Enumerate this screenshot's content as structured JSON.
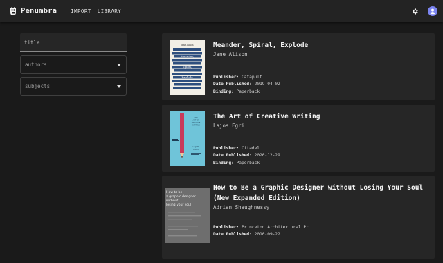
{
  "app": {
    "name": "Penumbra",
    "nav": [
      "IMPORT",
      "LIBRARY"
    ]
  },
  "filters": {
    "title_placeholder": "title",
    "authors_label": "authors",
    "subjects_label": "subjects"
  },
  "labels": {
    "publisher": "Publisher:",
    "date_published": "Date Published:",
    "binding": "Binding:"
  },
  "books": [
    {
      "title": "Meander, Spiral, Explode",
      "author": "Jane Alison",
      "publisher": "Catapult",
      "date_published": "2019-04-02",
      "binding": "Paperback",
      "cover": {
        "author_line": "Jane Alison",
        "words": [
          "Meander,",
          "Spiral,",
          "Explode"
        ],
        "colors": {
          "bg": "#f2efe6",
          "stripes": "#2e4f7e"
        }
      }
    },
    {
      "title": "The Art of Creative Writing",
      "author": "Lajos Egri",
      "publisher": "Citadel",
      "date_published": "2020-12-29",
      "binding": "Paperback",
      "cover": {
        "title_lines": [
          "THE",
          "ART OF",
          "CREATIVE",
          "WRITING"
        ],
        "author_lines": [
          "LAJOS",
          "EGRI"
        ],
        "colors": {
          "bg": "#6fc4d9",
          "pencil": "#c93a5a"
        }
      }
    },
    {
      "title": "How to Be a Graphic Designer without Losing Your Soul (New Expanded Edition)",
      "author": "Adrian Shaughnessy",
      "publisher": "Princeton Architectural Pr…",
      "date_published": "2010-09-22",
      "cover": {
        "lines": [
          "How to be",
          "a graphic designer",
          "without",
          "losing your soul"
        ],
        "colors": {
          "bg": "#6e6e6e"
        }
      }
    }
  ]
}
